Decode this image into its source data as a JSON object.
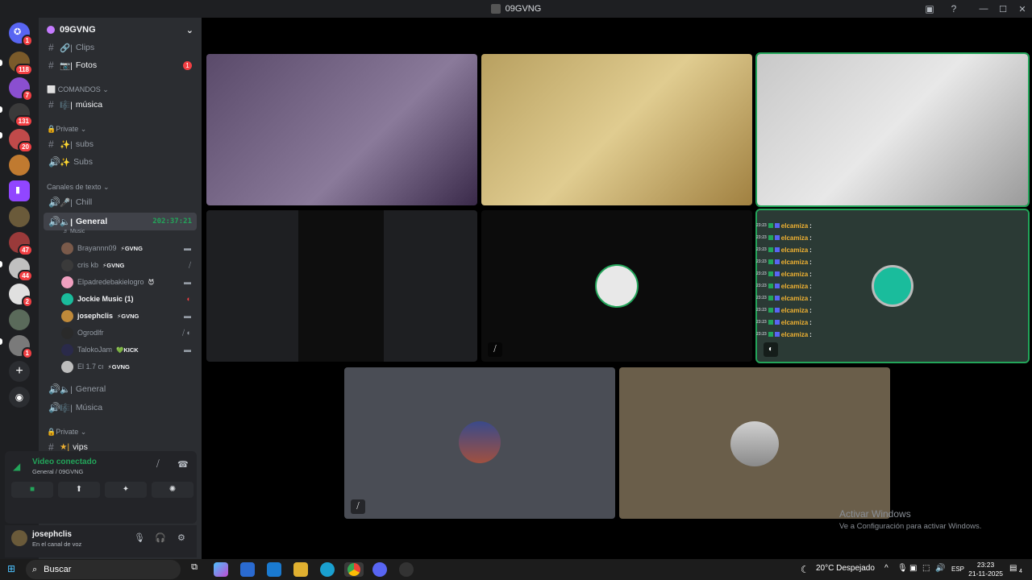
{
  "window": {
    "title": "09GVNG",
    "controls": [
      "—",
      "☐",
      "✕"
    ]
  },
  "guilds": [
    {
      "name": "home",
      "badge": "1",
      "color": "#5865f2"
    },
    {
      "name": "guild-1",
      "badge": "118",
      "color": "#7a5a2a"
    },
    {
      "name": "guild-2",
      "badge": "7",
      "color": "#8a4fd0"
    },
    {
      "name": "guild-3",
      "badge": "131",
      "color": "#3a3a3a"
    },
    {
      "name": "guild-4",
      "badge": "20",
      "color": "#c04a4a"
    },
    {
      "name": "guild-5",
      "badge": "",
      "color": "#c07a30"
    },
    {
      "name": "twitch",
      "badge": "",
      "color": "#9146ff"
    },
    {
      "name": "guild-7",
      "badge": "",
      "color": "#6a5a3a"
    },
    {
      "name": "guild-8",
      "badge": "47",
      "color": "#9a3a3a"
    },
    {
      "name": "guild-9",
      "badge": "44",
      "color": "#c0c0c0"
    },
    {
      "name": "guild-10",
      "badge": "2",
      "color": "#e0e0e0"
    },
    {
      "name": "guild-11",
      "badge": "",
      "color": "#5a6a5a"
    },
    {
      "name": "guild-12",
      "badge": "1",
      "color": "#7a7a7a"
    }
  ],
  "server": {
    "name": "09GVNG"
  },
  "channels": {
    "clips": "Clips",
    "fotos": "Fotos",
    "fotos_badge": "1",
    "cat_comandos": "COMANDOS",
    "musica_cmd": "música",
    "cat_private": "Private",
    "subs_text": "subs",
    "subs_voice": "Subs",
    "cat_canales": "Canales de texto",
    "chill": "Chill",
    "general": "General",
    "general_timer": "202:37:21",
    "general_sub": "Music",
    "general1": "General",
    "musica_voice": "Música",
    "cat_private2": "Private",
    "vips1": "vips",
    "vips2": "vips"
  },
  "voice_users": [
    {
      "name": "Brayannn09",
      "tag": "⚡GVNG",
      "color": "#7a5a4a",
      "icon": "📹"
    },
    {
      "name": "cris kb",
      "tag": "⚡GVNG",
      "color": "#3a3a3a",
      "icon": "🎙"
    },
    {
      "name": "Elpadredebakielogro",
      "tag": "😈",
      "color": "#f0a0c0",
      "icon": "📹"
    },
    {
      "name": "Jockie Music (1)",
      "tag": "",
      "color": "#1abc9c",
      "icon": "🎧"
    },
    {
      "name": "josephclis",
      "tag": "⚡GVNG",
      "color": "#c08a3a",
      "icon": "📹"
    },
    {
      "name": "Ogrodlfr",
      "tag": "",
      "color": "#2a2a2a",
      "icon": "🎙"
    },
    {
      "name": "TalokoJam",
      "tag": "💚KICK",
      "color": "#2a2a4a",
      "icon": "📹"
    },
    {
      "name": "El 1.7 cı",
      "tag": "⚡GVNG",
      "color": "#bdbdbd",
      "icon": ""
    }
  ],
  "voice_panel": {
    "title": "Video conectado",
    "subtitle": "General / 09GVNG",
    "buttons": [
      "■",
      "⬆",
      "✦",
      "✺"
    ]
  },
  "user": {
    "name": "josephclis",
    "status": "En el canal de voz"
  },
  "chat_overlay": {
    "user": "elcamiza",
    "time": "23:23",
    "lines": 10
  },
  "watermark": {
    "line1": "Activar Windows",
    "line2": "Ve a Configuración para activar Windows."
  },
  "taskbar": {
    "search": "Buscar",
    "weather": "20°C  Despejado",
    "lang": "ESP",
    "time": "23:23",
    "date": "21-11-2025",
    "notif": "4"
  }
}
